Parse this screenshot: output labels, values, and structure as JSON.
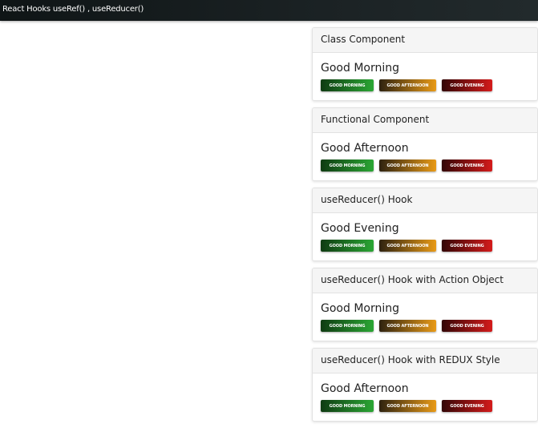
{
  "window": {
    "title": "React Hooks useRef() , useReducer()"
  },
  "buttons": {
    "morning_label": "GOOD MORNING",
    "afternoon_label": "GOOD AFTERNOON",
    "evening_label": "GOOD EVENING"
  },
  "colors": {
    "morning": "#2ba634",
    "afternoon": "#e89a17",
    "evening": "#d41b1b",
    "topbar": "#1b2224"
  },
  "cards": [
    {
      "header": "Class Component",
      "greeting": "Good Morning"
    },
    {
      "header": "Functional Component",
      "greeting": "Good Afternoon"
    },
    {
      "header": "useReducer() Hook",
      "greeting": "Good Evening"
    },
    {
      "header": "useReducer() Hook with Action Object",
      "greeting": "Good Morning"
    },
    {
      "header": "useReducer() Hook with REDUX Style",
      "greeting": "Good Afternoon"
    }
  ]
}
